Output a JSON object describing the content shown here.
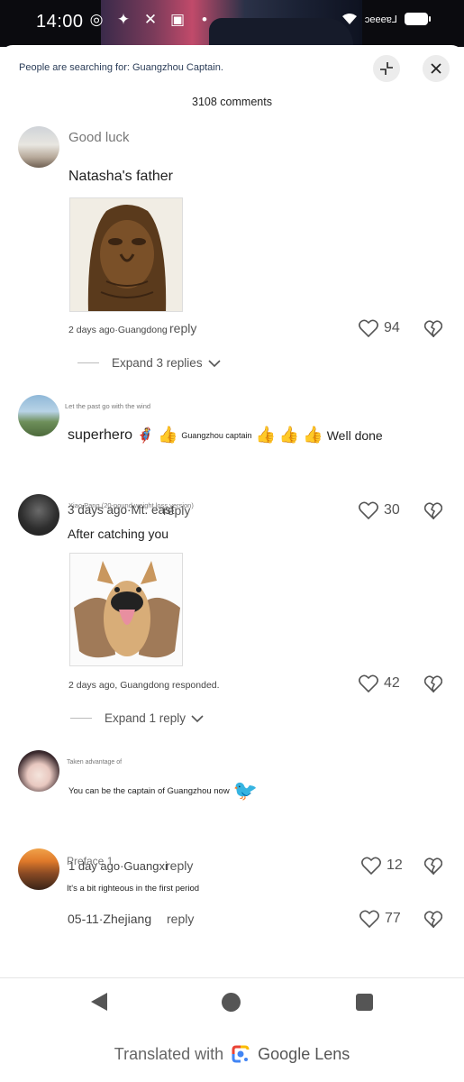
{
  "status_bar": {
    "time": "14:00",
    "carrier": "ɔeeeɐ⅃"
  },
  "header": {
    "searching_text": "People are searching for: Guangzhou Captain.",
    "comment_count": "3108 comments"
  },
  "comments": [
    {
      "username": "Good luck",
      "text": "Natasha's father",
      "time_location": "2 days ago·Guangdong",
      "reply_label": "reply",
      "likes": "94",
      "expand_label": "Expand 3 replies"
    },
    {
      "username": "Let the past go with the wind",
      "text_parts": [
        "superhero",
        "Guangzhou captain",
        "Well done"
      ],
      "time_location": "3 days ago·Mt. east",
      "reply_label": "reply",
      "likes": "30"
    },
    {
      "username": "Xiao Pang (20-pound weight loss version)",
      "text": "After catching you",
      "time_location": "2 days ago, Guangdong responded.",
      "likes": "42",
      "expand_label": "Expand 1 reply"
    },
    {
      "username": "Taken advantage of",
      "text": "You can be the captain of Guangzhou now",
      "time_location": "1 day ago·Guangxi",
      "reply_label": "reply",
      "likes": "12"
    },
    {
      "username": "Preface 1",
      "text": "It's a bit righteous in the first period",
      "time_location": "05-11·Zhejiang",
      "reply_label": "reply",
      "likes": "77"
    }
  ],
  "footer": {
    "translated_with": "Translated with",
    "lens_name": "Google Lens"
  }
}
